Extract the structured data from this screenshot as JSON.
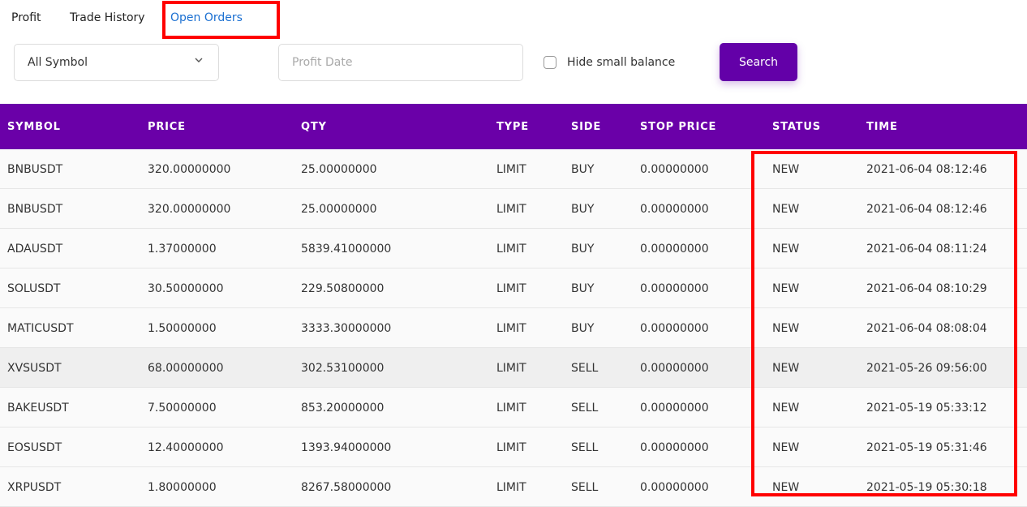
{
  "tabs": [
    "Profit",
    "Trade History",
    "Open Orders"
  ],
  "active_tab": "Open Orders",
  "filters": {
    "symbol_select": "All Symbol",
    "date_placeholder": "Profit Date",
    "hide_small_label": "Hide small balance",
    "search_label": "Search"
  },
  "colors": {
    "accent": "#6300a8",
    "header_bg": "#6a00a8",
    "active_tab": "#1a6fd1",
    "highlight": "#ff0000"
  },
  "table": {
    "headers": [
      "SYMBOL",
      "PRICE",
      "QTY",
      "TYPE",
      "SIDE",
      "STOP PRICE",
      "STATUS",
      "TIME"
    ],
    "rows": [
      [
        "BNBUSDT",
        "320.00000000",
        "25.00000000",
        "LIMIT",
        "BUY",
        "0.00000000",
        "NEW",
        "2021-06-04 08:12:46"
      ],
      [
        "BNBUSDT",
        "320.00000000",
        "25.00000000",
        "LIMIT",
        "BUY",
        "0.00000000",
        "NEW",
        "2021-06-04 08:12:46"
      ],
      [
        "ADAUSDT",
        "1.37000000",
        "5839.41000000",
        "LIMIT",
        "BUY",
        "0.00000000",
        "NEW",
        "2021-06-04 08:11:24"
      ],
      [
        "SOLUSDT",
        "30.50000000",
        "229.50800000",
        "LIMIT",
        "BUY",
        "0.00000000",
        "NEW",
        "2021-06-04 08:10:29"
      ],
      [
        "MATICUSDT",
        "1.50000000",
        "3333.30000000",
        "LIMIT",
        "BUY",
        "0.00000000",
        "NEW",
        "2021-06-04 08:08:04"
      ],
      [
        "XVSUSDT",
        "68.00000000",
        "302.53100000",
        "LIMIT",
        "SELL",
        "0.00000000",
        "NEW",
        "2021-05-26 09:56:00"
      ],
      [
        "BAKEUSDT",
        "7.50000000",
        "853.20000000",
        "LIMIT",
        "SELL",
        "0.00000000",
        "NEW",
        "2021-05-19 05:33:12"
      ],
      [
        "EOSUSDT",
        "12.40000000",
        "1393.94000000",
        "LIMIT",
        "SELL",
        "0.00000000",
        "NEW",
        "2021-05-19 05:31:46"
      ],
      [
        "XRPUSDT",
        "1.80000000",
        "8267.58000000",
        "LIMIT",
        "SELL",
        "0.00000000",
        "NEW",
        "2021-05-19 05:30:18"
      ]
    ]
  }
}
